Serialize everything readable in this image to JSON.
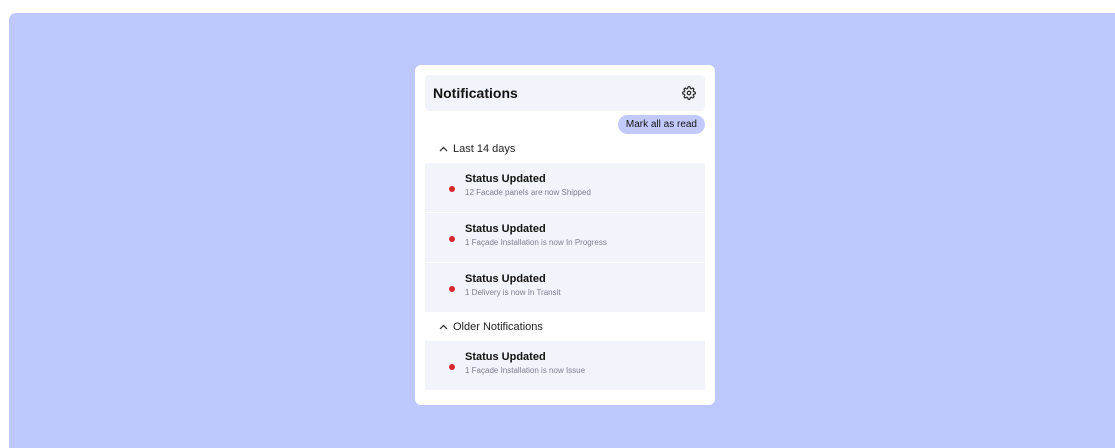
{
  "panel": {
    "title": "Notifications",
    "settings_icon": "gear-icon",
    "mark_all_label": "Mark all as read"
  },
  "groups": [
    {
      "label": "Last 14 days",
      "items": [
        {
          "title": "Status Updated",
          "subtitle": "12 Facade panels are now Shipped",
          "unread": true
        },
        {
          "title": "Status Updated",
          "subtitle": "1 Façade Installation is now In Progress",
          "unread": true
        },
        {
          "title": "Status Updated",
          "subtitle": "1 Delivery is now In Transit",
          "unread": true
        }
      ]
    },
    {
      "label": "Older Notifications",
      "items": [
        {
          "title": "Status Updated",
          "subtitle": "1 Façade Installation is now Issue",
          "unread": true
        }
      ]
    }
  ],
  "colors": {
    "background": "#bfc8fd",
    "accent": "#c2cafc",
    "unread_dot": "#d8262c"
  }
}
